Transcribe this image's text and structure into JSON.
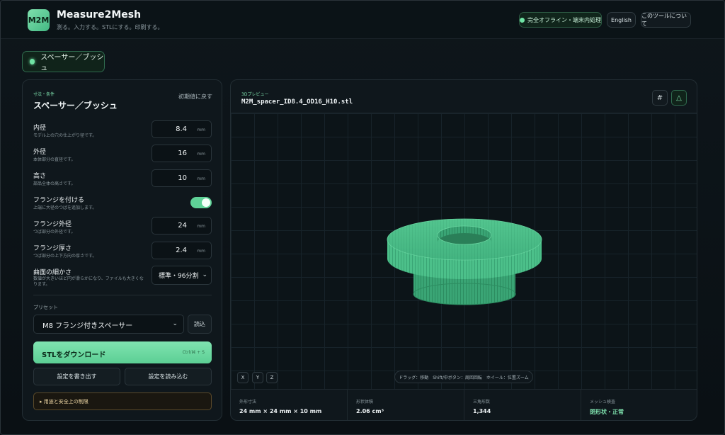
{
  "header": {
    "logo_text": "M2M",
    "title": "Measure2Mesh",
    "subtitle": "測る。入力する。STLにする。印刷する。",
    "offline_badge": "完全オフライン・端末内処理",
    "lang_button": "English",
    "about_button": "このツールについて"
  },
  "mode": {
    "label": "スペーサー／ブッシュ"
  },
  "form": {
    "section_label": "寸法・条件",
    "title": "スペーサー／ブッシュ",
    "reset": "初期値に戻す",
    "fields": [
      {
        "label": "内径",
        "help": "モデル上の穴の仕上がり径です。",
        "value": "8.4",
        "unit": "mm"
      },
      {
        "label": "外径",
        "help": "本体部分の直径です。",
        "value": "16",
        "unit": "mm"
      },
      {
        "label": "高さ",
        "help": "部品全体の高さです。",
        "value": "10",
        "unit": "mm"
      },
      {
        "label": "フランジを付ける",
        "help": "上端に大径のつばを追加します。"
      },
      {
        "label": "フランジ外径",
        "help": "つば部分の外径です。",
        "value": "24",
        "unit": "mm"
      },
      {
        "label": "フランジ厚さ",
        "help": "つば部分の上下方向の厚さです。",
        "value": "2.4",
        "unit": "mm"
      },
      {
        "label": "曲面の細かさ",
        "help": "数値が大きいほど円が滑らかになり、ファイルも大きくなります。",
        "value": "標準・96分割"
      }
    ],
    "preset_label": "プリセット",
    "preset_value": "M8 フランジ付きスペーサー",
    "preset_load": "読込",
    "download": "STLをダウンロード",
    "download_shortcut": "Ctrl/⌘ + S",
    "export_settings": "設定を書き出す",
    "import_settings": "設定を読み込む",
    "notice": "用途と安全上の制限"
  },
  "preview": {
    "label": "3Dプレビュー",
    "filename": "M2M_spacer_ID8.4_OD16_H10.stl",
    "axes": [
      "X",
      "Y",
      "Z"
    ],
    "hint": "ドラッグ：移動　Shift/中ボタン：周回回転　ホイール：位置ズーム",
    "stats": [
      {
        "key": "外形寸法",
        "value": "24 mm × 24 mm × 10 mm"
      },
      {
        "key": "形状体積",
        "value": "2.06 cm³"
      },
      {
        "key": "三角形数",
        "value": "1,344"
      },
      {
        "key": "メッシュ検査",
        "value": "閉形状・正常"
      }
    ]
  },
  "colors": {
    "accent": "#6fe3a4",
    "model": "#3fae7c",
    "background": "#0b1116"
  }
}
